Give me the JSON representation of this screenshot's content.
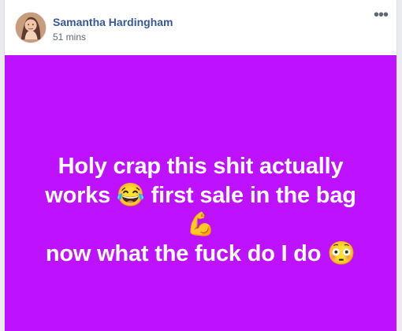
{
  "post": {
    "author": "Samantha Hardingham",
    "timestamp": "51 mins",
    "more_menu": "•••",
    "text": "Holy crap this shit actually\nworks 😂 first sale in the bag 💪\nnow what the fuck do I do 😳",
    "background_color": "#bd11ff"
  },
  "icons": {
    "avatar": "avatar",
    "more": "more-options-icon"
  }
}
